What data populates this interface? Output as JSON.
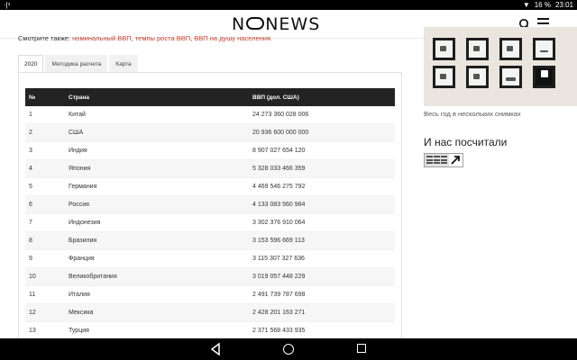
{
  "status": {
    "left": "·|¹",
    "battery": "16 %",
    "time": "23:01"
  },
  "header": {
    "logo_part1": "N",
    "logo_part2": "NEWS",
    "search_icon": "search-icon",
    "menu_icon": "hamburger-menu-icon"
  },
  "see_also": {
    "prefix": "Смотрите также:",
    "links": [
      "номинальный ВВП",
      "темпы роста ВВП",
      "ВВП на душу населения"
    ]
  },
  "tabs": [
    {
      "label": "2020"
    },
    {
      "label": "Методика расчета"
    },
    {
      "label": "Карта"
    }
  ],
  "table": {
    "headers": [
      "№",
      "Страна",
      "ВВП (дол. США)"
    ],
    "rows": [
      [
        "1",
        "Китай",
        "24 273 360 028 006"
      ],
      [
        "2",
        "США",
        "20 936 600 000 000"
      ],
      [
        "3",
        "Индия",
        "8 907 027 654 120"
      ],
      [
        "4",
        "Япония",
        "5 328 033 466 359"
      ],
      [
        "5",
        "Германия",
        "4 469 546 275 792"
      ],
      [
        "6",
        "Россия",
        "4 133 083 560 984"
      ],
      [
        "7",
        "Индонезия",
        "3 302 376 910 064"
      ],
      [
        "8",
        "Бразилия",
        "3 153 596 669 113"
      ],
      [
        "9",
        "Франция",
        "3 115 307 327 636"
      ],
      [
        "10",
        "Великобритания",
        "3 019 057 448 229"
      ],
      [
        "11",
        "Италия",
        "2 491 739 787 698"
      ],
      [
        "12",
        "Мексика",
        "2 428 201 163 271"
      ],
      [
        "13",
        "Турция",
        "2 371 568 433 935"
      ]
    ]
  },
  "sidebar": {
    "caption": "Весь год в нескольких снимках",
    "heading": "И нас посчитали"
  }
}
